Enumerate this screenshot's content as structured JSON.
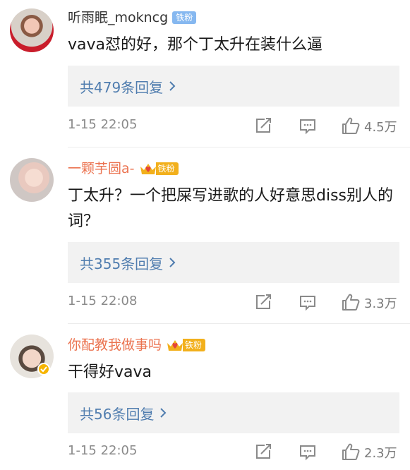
{
  "comments": [
    {
      "name": "听雨眠_mokncg",
      "badge": "铁粉",
      "text": "vava怼的好，那个丁太升在装什么逼",
      "reply_label": "共479条回复",
      "time": "1-15 22:05",
      "likes": "4.5万"
    },
    {
      "name": "一颗芋圆a-",
      "badge": "铁粉",
      "text": "丁太升？一个把屎写进歌的人好意思diss别人的词？",
      "reply_label": "共355条回复",
      "time": "1-15 22:08",
      "likes": "3.3万"
    },
    {
      "name": "你配教我做事吗",
      "badge": "铁粉",
      "text": "干得好vava",
      "reply_label": "共56条回复",
      "time": "1-15 22:05",
      "likes": "2.3万"
    }
  ],
  "icons": {
    "share": "share-icon",
    "comment": "comment-icon",
    "like": "like-icon",
    "reply_arrow": "chevron-right-icon",
    "crown": "crown-icon"
  },
  "colors": {
    "name_gray": "#333333",
    "name_orange": "#eb7350",
    "reply_blue": "#507daf",
    "badge_blue": "#86b8f0",
    "badge_gold": "#f2b01c"
  }
}
